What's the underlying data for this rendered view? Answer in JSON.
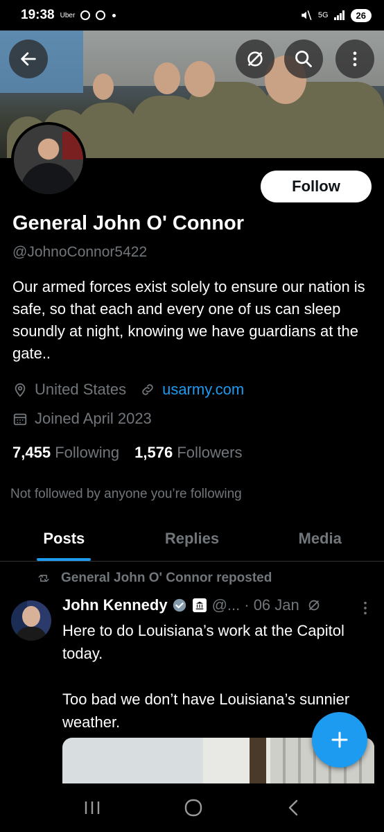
{
  "status_bar": {
    "time": "19:38",
    "app": "Uber",
    "network": "5G",
    "battery": "26"
  },
  "header": {
    "back_icon": "arrow-left-icon",
    "hide_icon": "eye-slash-icon",
    "search_icon": "search-icon",
    "more_icon": "more-vertical-icon"
  },
  "profile": {
    "follow_label": "Follow",
    "name": "General John O' Connor",
    "handle": "@JohnoConnor5422",
    "bio": "Our armed forces exist solely to ensure our nation is safe, so that each and every one of us can sleep soundly at night, knowing we have guardians at the gate..",
    "location": "United States",
    "website": "usarmy.com",
    "joined": "Joined April 2023",
    "following_count": "7,455",
    "following_label": "Following",
    "followers_count": "1,576",
    "followers_label": "Followers",
    "not_followed_text": "Not followed by anyone you’re following"
  },
  "tabs": [
    {
      "label": "Posts",
      "active": true
    },
    {
      "label": "Replies",
      "active": false
    },
    {
      "label": "Media",
      "active": false
    }
  ],
  "post": {
    "repost_text": "General John O' Connor reposted",
    "author_name": "John Kennedy",
    "author_handle": "@...",
    "date": "· 06 Jan",
    "text": "Here to do Louisiana’s work at the Capitol today.\n\nToo bad we don’t have Louisiana’s sunnier weather."
  },
  "colors": {
    "accent": "#1d9bf0",
    "background": "#000000",
    "muted_text": "#71767b"
  }
}
